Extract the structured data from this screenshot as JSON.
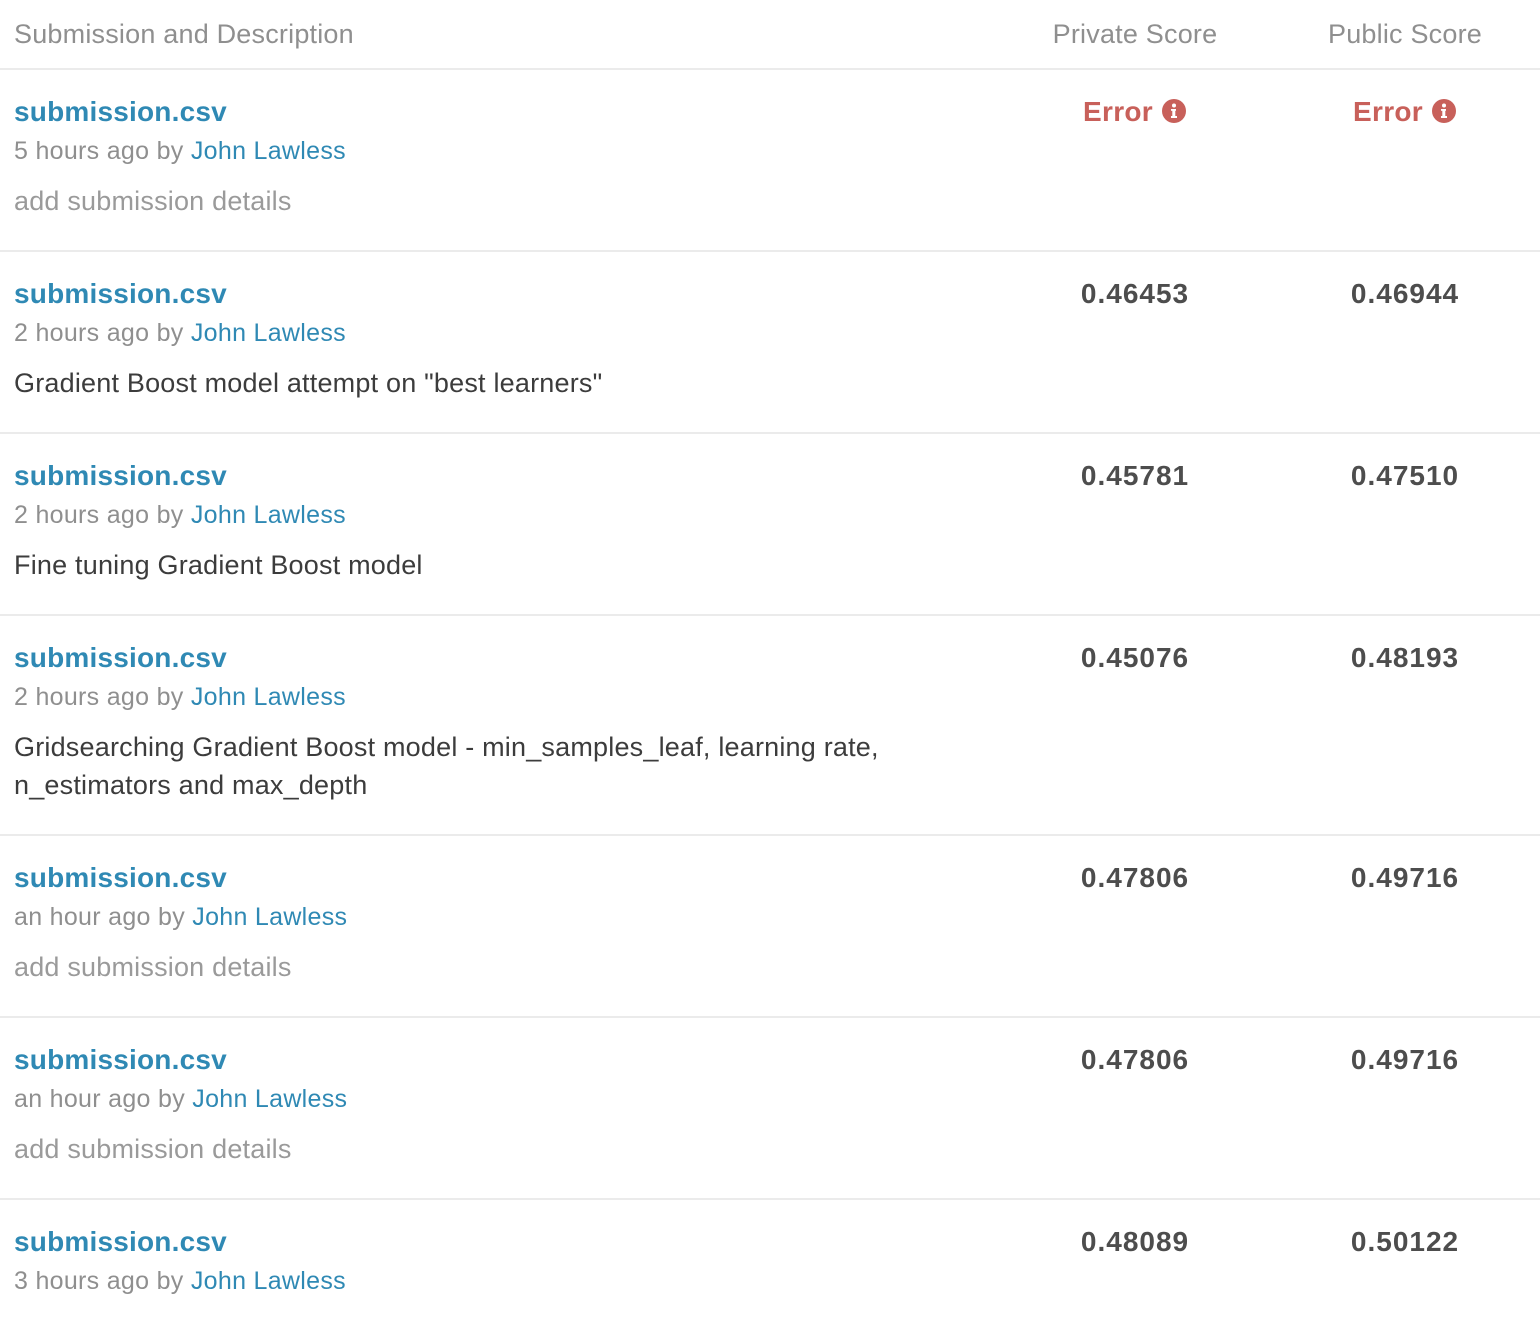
{
  "header": {
    "desc": "Submission and Description",
    "private": "Private Score",
    "public": "Public Score"
  },
  "rows": [
    {
      "file": "submission.csv",
      "time": "5 hours ago",
      "by": "by",
      "author": "John Lawless",
      "details": "add submission details",
      "private": "Error",
      "public": "Error"
    },
    {
      "file": "submission.csv",
      "time": "2 hours ago",
      "by": "by",
      "author": "John Lawless",
      "details": "Gradient Boost model attempt on \"best learners\"",
      "private": "0.46453",
      "public": "0.46944"
    },
    {
      "file": "submission.csv",
      "time": "2 hours ago",
      "by": "by",
      "author": "John Lawless",
      "details": "Fine tuning Gradient Boost model",
      "private": "0.45781",
      "public": "0.47510"
    },
    {
      "file": "submission.csv",
      "time": "2 hours ago",
      "by": "by",
      "author": "John Lawless",
      "details": "Gridsearching Gradient Boost model - min_samples_leaf, learning rate, n_estimators and max_depth",
      "private": "0.45076",
      "public": "0.48193"
    },
    {
      "file": "submission.csv",
      "time": "an hour ago",
      "by": "by",
      "author": "John Lawless",
      "details": "add submission details",
      "private": "0.47806",
      "public": "0.49716"
    },
    {
      "file": "submission.csv",
      "time": "an hour ago",
      "by": "by",
      "author": "John Lawless",
      "details": "add submission details",
      "private": "0.47806",
      "public": "0.49716"
    },
    {
      "file": "submission.csv",
      "time": "3 hours ago",
      "by": "by",
      "author": "John Lawless",
      "details": "",
      "private": "0.48089",
      "public": "0.50122"
    }
  ],
  "colors": {
    "link": "#2f89b4",
    "error": "#c8605a",
    "muted": "#8f8f8f"
  },
  "icons": {
    "error_info": "info-circle-icon"
  }
}
